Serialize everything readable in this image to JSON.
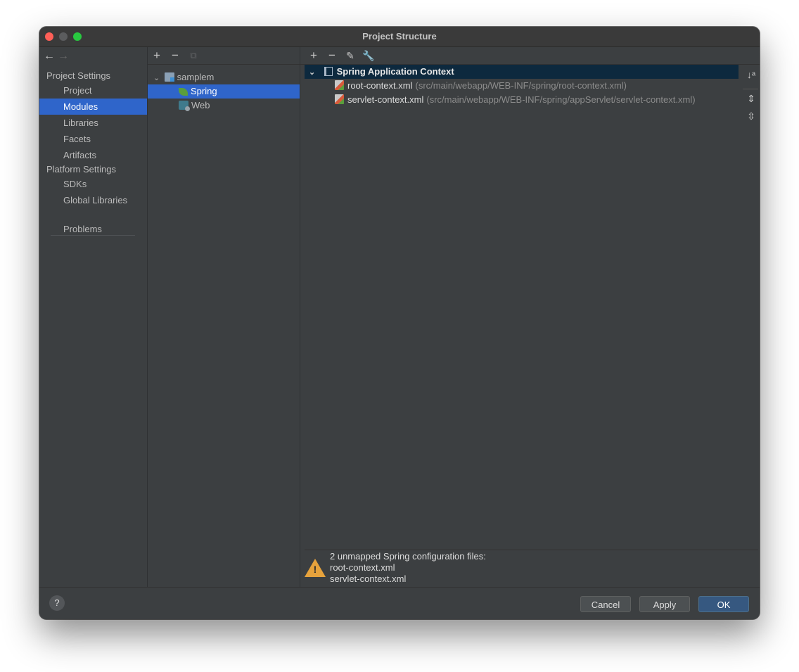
{
  "window": {
    "title": "Project Structure"
  },
  "nav": {
    "project_settings_label": "Project Settings",
    "platform_settings_label": "Platform Settings",
    "items": [
      {
        "label": "Project"
      },
      {
        "label": "Modules"
      },
      {
        "label": "Libraries"
      },
      {
        "label": "Facets"
      },
      {
        "label": "Artifacts"
      },
      {
        "label": "SDKs"
      },
      {
        "label": "Global Libraries"
      },
      {
        "label": "Problems"
      }
    ],
    "selected": "Modules"
  },
  "module_tree": {
    "root": {
      "label": "samplem",
      "expanded": true
    },
    "children": [
      {
        "label": "Spring",
        "icon": "spring-leaf-icon",
        "selected": true
      },
      {
        "label": "Web",
        "icon": "web-facet-icon"
      }
    ]
  },
  "spring_context": {
    "header_label": "Spring Application Context",
    "files": [
      {
        "name": "root-context.xml",
        "path": "(src/main/webapp/WEB-INF/spring/root-context.xml)"
      },
      {
        "name": "servlet-context.xml",
        "path": "(src/main/webapp/WEB-INF/spring/appServlet/servlet-context.xml)"
      }
    ]
  },
  "warning": {
    "line1": "2 unmapped Spring configuration files:",
    "line2": "root-context.xml",
    "line3": "servlet-context.xml"
  },
  "footer": {
    "help_label": "?",
    "cancel_label": "Cancel",
    "apply_label": "Apply",
    "ok_label": "OK"
  },
  "colors": {
    "selection": "#2f65ca",
    "context_header": "#0d293e",
    "warning": "#e6a23c",
    "primary_button": "#365880"
  }
}
